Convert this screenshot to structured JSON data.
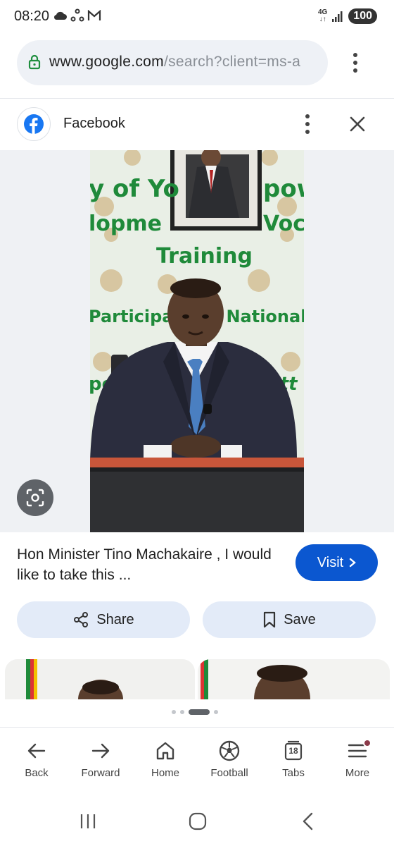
{
  "status_bar": {
    "time": "08:20",
    "network": "4G",
    "battery": "100"
  },
  "url_bar": {
    "domain": "www.google.com",
    "path": "/search?client=ms-a"
  },
  "source": {
    "name": "Facebook"
  },
  "image_signage": {
    "line1": "y of Yo",
    "line1b": "powe",
    "line2": "lopme",
    "line2b": "Voc",
    "line3": "Training",
    "line4": "Participa",
    "line4b": "n National",
    "side_left": "po",
    "side_right": "ett"
  },
  "result": {
    "caption": "Hon Minister Tino Machakaire , I would like to take this ...",
    "visit_label": "Visit",
    "share_label": "Share",
    "save_label": "Save"
  },
  "bottom_nav": {
    "items": [
      {
        "label": "Back",
        "icon": "arrow-left-icon"
      },
      {
        "label": "Forward",
        "icon": "arrow-right-icon"
      },
      {
        "label": "Home",
        "icon": "home-icon"
      },
      {
        "label": "Football",
        "icon": "football-icon"
      },
      {
        "label": "Tabs",
        "icon": "tabs-icon"
      },
      {
        "label": "More",
        "icon": "menu-icon"
      }
    ],
    "tabs_count": "18"
  },
  "colors": {
    "accent": "#0b57d0",
    "pill": "#e3ebf8",
    "url_bar": "#eef1f6",
    "facebook": "#1877f2"
  }
}
